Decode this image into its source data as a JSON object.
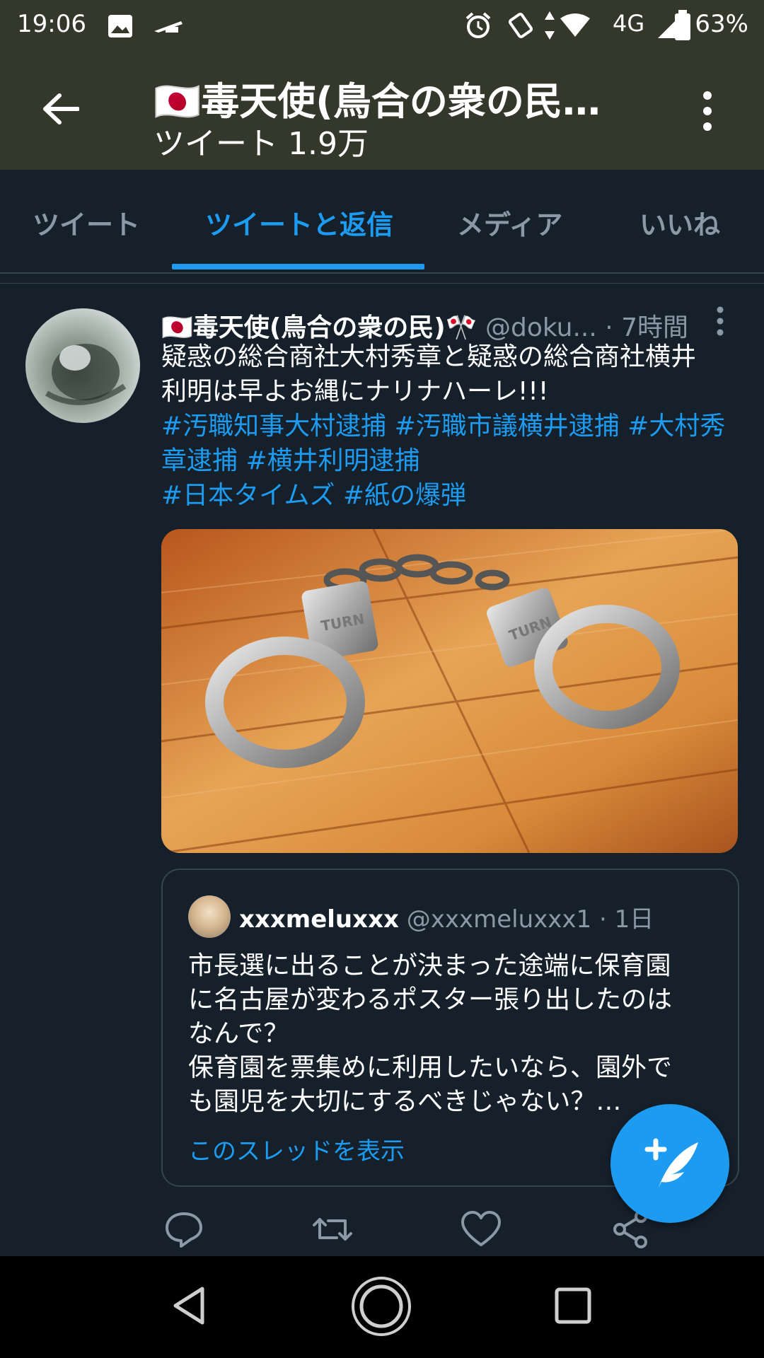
{
  "status_bar": {
    "time": "19:06",
    "network": "4G",
    "battery": "63%"
  },
  "header": {
    "title": "🇯🇵毒天使(鳥合の衆の民…",
    "subtitle": "ツイート 1.9万"
  },
  "tabs": [
    {
      "label": "ツイート",
      "active": false
    },
    {
      "label": "ツイートと返信",
      "active": true
    },
    {
      "label": "メディア",
      "active": false
    },
    {
      "label": "いいね",
      "active": false
    }
  ],
  "tweet": {
    "name": "🇯🇵毒天使(鳥合の衆の民)🎌",
    "handle": "@doku...",
    "time": "· 7時間",
    "text_line1": "疑惑の総合商社大村秀章と疑惑の総合商社横井",
    "text_line2": "利明は早よお縄にナリナハーレ!!!",
    "hashtags_line1": "#汚職知事大村逮捕 #汚職市議横井逮捕 #大村秀",
    "hashtags_line2": "章逮捕 #横井利明逮捕",
    "hashtags_line3": "#日本タイムズ #紙の爆弾",
    "image_alt": "handcuffs-on-wooden-floor",
    "cuff_text": "TURN"
  },
  "quote": {
    "name": "xxxmeluxxx",
    "handle": "@xxxmeluxxx1",
    "time": "· 1日",
    "line1": "市長選に出ることが決まった途端に保育園",
    "line2": "に名古屋が変わるポスター張り出したのは",
    "line3": "なんで？",
    "line4": "保育園を票集めに利用したいなら、園外で",
    "line5": "も園児を大切にするべきじゃない？…",
    "show_thread": "このスレッドを表示"
  },
  "colors": {
    "background": "#15202b",
    "header_bg": "#34382a",
    "accent": "#1d9bf0",
    "muted_text": "#8b98a5",
    "border": "#38444d"
  },
  "icons": {
    "back": "arrow-left-icon",
    "more": "vertical-dots-icon",
    "reply": "reply-icon",
    "retweet": "retweet-icon",
    "like": "heart-icon",
    "share": "share-icon",
    "compose": "compose-feather-icon"
  }
}
